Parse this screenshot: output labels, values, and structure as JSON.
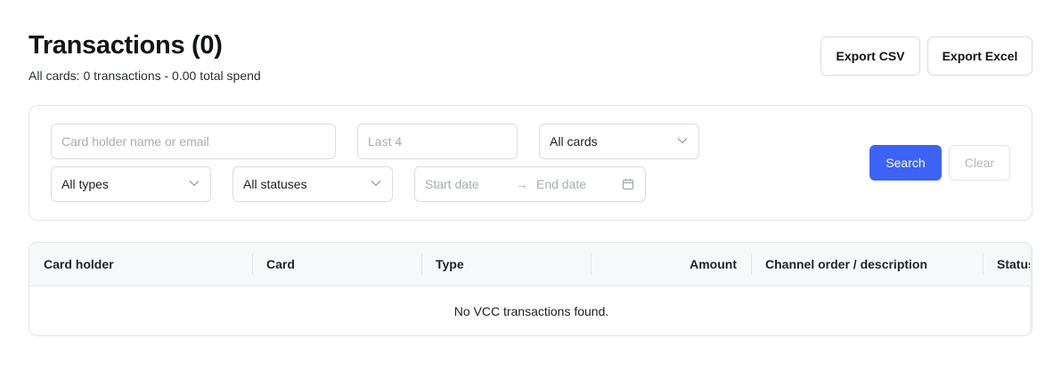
{
  "header": {
    "title": "Transactions (0)",
    "subtitle": "All cards: 0 transactions - 0.00 total spend",
    "export_csv_label": "Export CSV",
    "export_excel_label": "Export Excel"
  },
  "filters": {
    "name_placeholder": "Card holder name or email",
    "last4_placeholder": "Last 4",
    "cards_value": "All cards",
    "types_value": "All types",
    "statuses_value": "All statuses",
    "start_date_placeholder": "Start date",
    "date_arrow": "→",
    "end_date_placeholder": "End date",
    "search_label": "Search",
    "clear_label": "Clear"
  },
  "table": {
    "columns": [
      "Card holder",
      "Card",
      "Type",
      "Amount",
      "Channel order / description",
      "Status"
    ],
    "empty_message": "No VCC transactions found."
  },
  "colors": {
    "accent": "#3c63f5",
    "border": "#e3e5e9",
    "header_bg": "#f7f8fa"
  },
  "icons": {
    "dropdown": "chevron-down-icon",
    "calendar": "calendar-icon"
  }
}
